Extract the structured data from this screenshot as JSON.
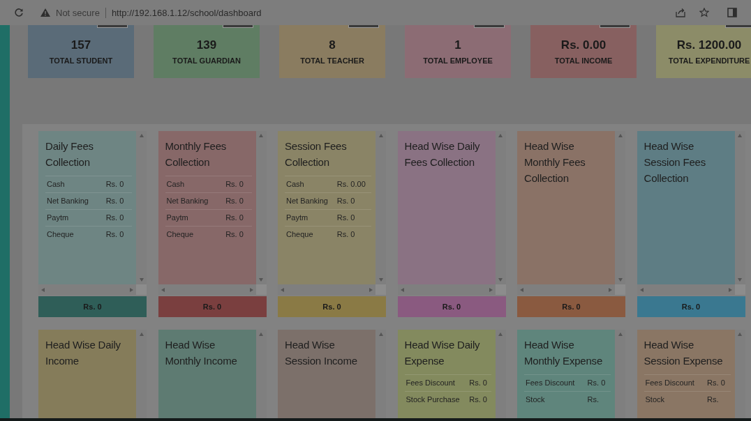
{
  "browser": {
    "security": "Not secure",
    "url": "http://192.168.1.12/school/dashboard"
  },
  "stats": [
    {
      "value": "157",
      "label": "TOTAL STUDENT",
      "color": "#5a6b78"
    },
    {
      "value": "139",
      "label": "TOTAL GUARDIAN",
      "color": "#5f7d63"
    },
    {
      "value": "8",
      "label": "TOTAL TEACHER",
      "color": "#8a7c60"
    },
    {
      "value": "1",
      "label": "TOTAL EMPLOYEE",
      "color": "#8c6c74"
    },
    {
      "value": "Rs. 0.00",
      "label": "TOTAL INCOME",
      "color": "#876060"
    },
    {
      "value": "Rs. 1200.00",
      "label": "TOTAL EXPENDITURE",
      "color": "#8c8c68"
    }
  ],
  "widgets": [
    {
      "title": "Daily Fees Collection",
      "color": "#6e8583",
      "footer": {
        "total": "Rs. 0",
        "color": "#2f5e58"
      },
      "rows": [
        {
          "label": "Cash",
          "value": "Rs. 0"
        },
        {
          "label": "Net Banking",
          "value": "Rs. 0"
        },
        {
          "label": "Paytm",
          "value": "Rs. 0"
        },
        {
          "label": "Cheque",
          "value": "Rs. 0"
        }
      ]
    },
    {
      "title": "Monthly Fees Collection",
      "color": "#876868",
      "footer": {
        "total": "Rs. 0",
        "color": "#7a3f3f"
      },
      "rows": [
        {
          "label": "Cash",
          "value": "Rs. 0"
        },
        {
          "label": "Net Banking",
          "value": "Rs. 0"
        },
        {
          "label": "Paytm",
          "value": "Rs. 0"
        },
        {
          "label": "Cheque",
          "value": "Rs. 0"
        }
      ]
    },
    {
      "title": "Session Fees Collection",
      "color": "#8a8466",
      "footer": {
        "total": "Rs. 0",
        "color": "#8a7a45"
      },
      "rows": [
        {
          "label": "Cash",
          "value": "Rs. 0.00"
        },
        {
          "label": "Net Banking",
          "value": "Rs. 0"
        },
        {
          "label": "Paytm",
          "value": "Rs. 0"
        },
        {
          "label": "Cheque",
          "value": "Rs. 0"
        }
      ]
    },
    {
      "title": "Head Wise Daily Fees Collection",
      "color": "#8a7283",
      "footer": {
        "total": "Rs. 0",
        "color": "#8a5a80"
      }
    },
    {
      "title": "Head Wise Monthly Fees Collection",
      "color": "#8a7266",
      "footer": {
        "total": "Rs. 0",
        "color": "#8a5a40"
      }
    },
    {
      "title": "Head Wise Session Fees Collection",
      "color": "#5e7d84",
      "footer": {
        "total": "Rs. 0",
        "color": "#3a7890"
      }
    },
    {
      "title": "Head Wise Daily Income",
      "color": "#857c5a"
    },
    {
      "title": "Head Wise Monthly Income",
      "color": "#5e7b72"
    },
    {
      "title": "Head Wise Session Income",
      "color": "#7c706a"
    },
    {
      "title": "Head Wise Daily Expense",
      "color": "#838a5e",
      "rows": [
        {
          "label": "Fees Discount",
          "value": "Rs. 0"
        },
        {
          "label": "Stock Purchase",
          "value": "Rs. 0"
        }
      ]
    },
    {
      "title": "Head Wise Monthly Expense",
      "color": "#5f857c",
      "rows": [
        {
          "label": "Fees Discount",
          "value": "Rs. 0"
        },
        {
          "label": "Stock",
          "value": "Rs."
        }
      ]
    },
    {
      "title": "Head Wise Session Expense",
      "color": "#8a7664",
      "rows": [
        {
          "label": "Fees Discount",
          "value": "Rs. 0"
        },
        {
          "label": "Stock",
          "value": "Rs."
        }
      ]
    }
  ]
}
